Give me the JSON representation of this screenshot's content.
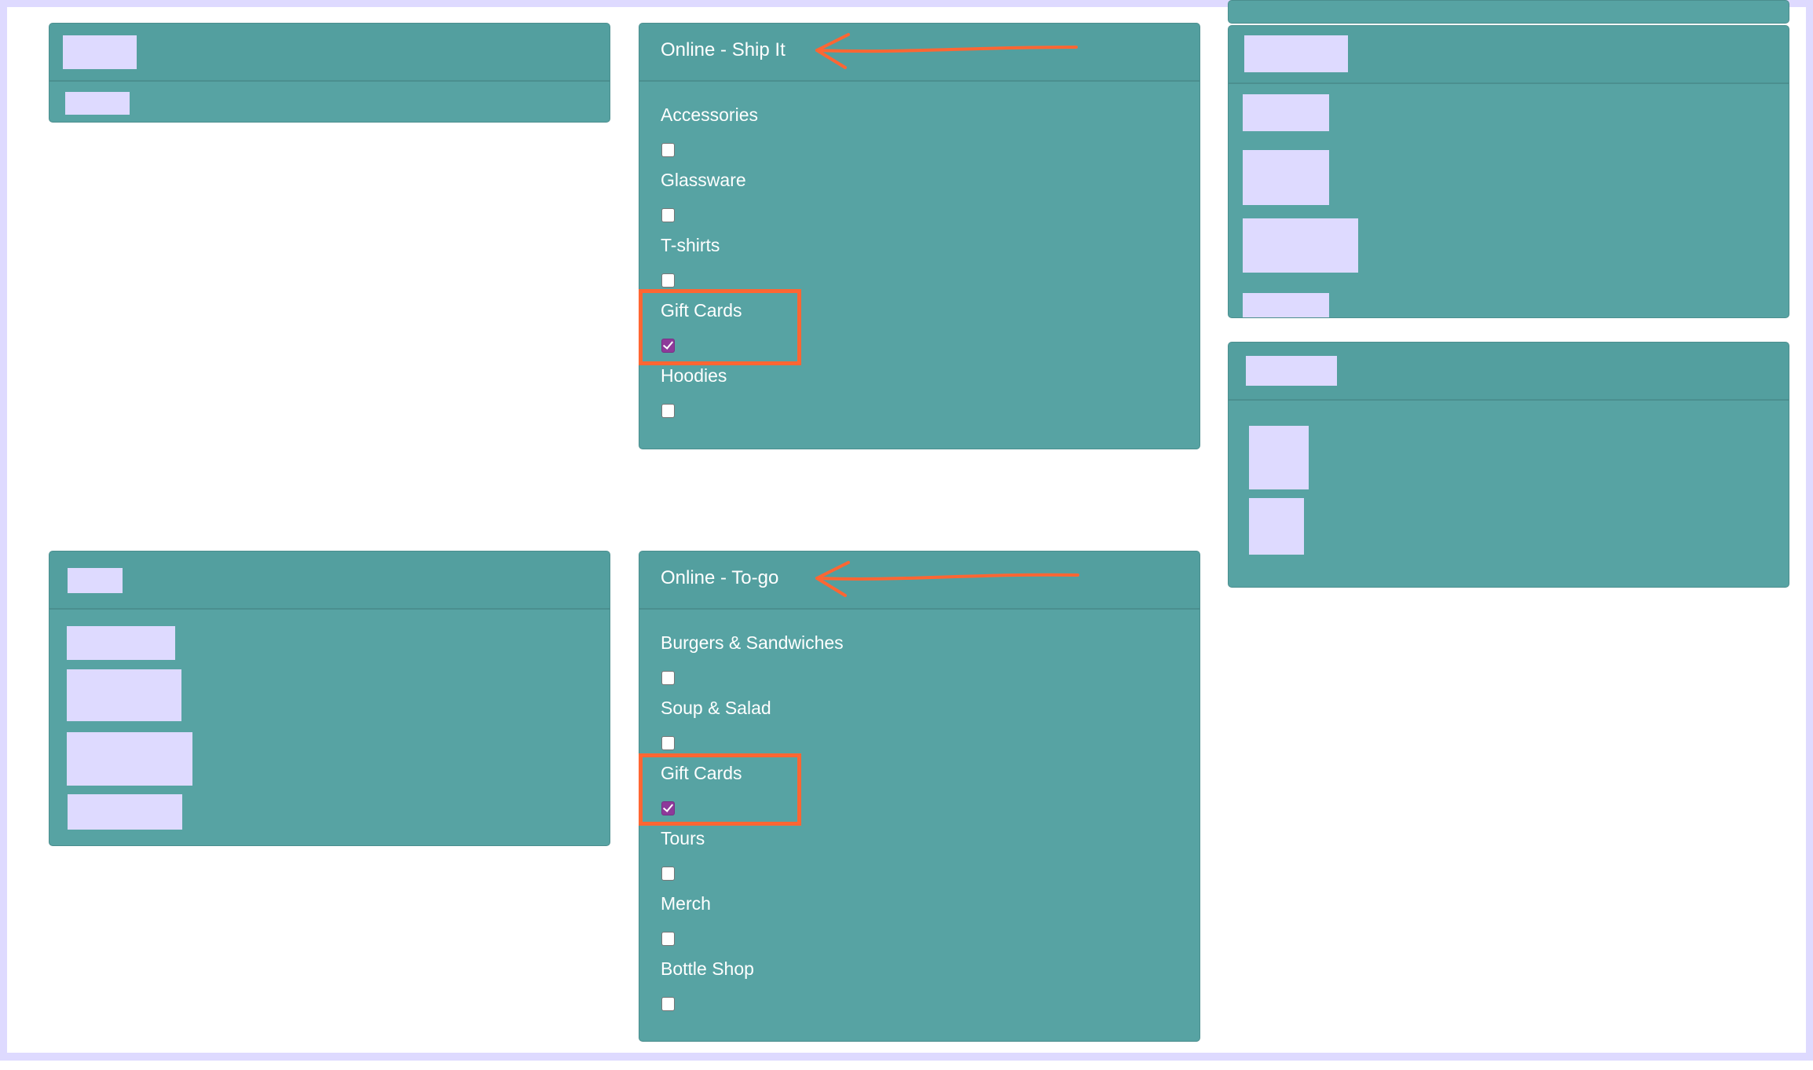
{
  "colors": {
    "panel": "#57a3a3",
    "highlight": "#ff6633",
    "checked": "#8e3a9a",
    "redaction": "#dedaff"
  },
  "ship_it": {
    "title": "Online - Ship It",
    "items": [
      {
        "label": "Accessories",
        "checked": false
      },
      {
        "label": "Glassware",
        "checked": false
      },
      {
        "label": "T-shirts",
        "checked": false
      },
      {
        "label": "Gift Cards",
        "checked": true
      },
      {
        "label": "Hoodies",
        "checked": false
      }
    ]
  },
  "to_go": {
    "title": "Online - To-go",
    "items": [
      {
        "label": "Burgers & Sandwiches",
        "checked": false
      },
      {
        "label": "Soup & Salad",
        "checked": false
      },
      {
        "label": "Gift Cards",
        "checked": true
      },
      {
        "label": "Tours",
        "checked": false
      },
      {
        "label": "Merch",
        "checked": false
      },
      {
        "label": "Bottle Shop",
        "checked": false
      }
    ]
  },
  "annotations": {
    "arrow_icon": "hand-drawn-left-arrow",
    "highlight": "orange-rectangle"
  }
}
